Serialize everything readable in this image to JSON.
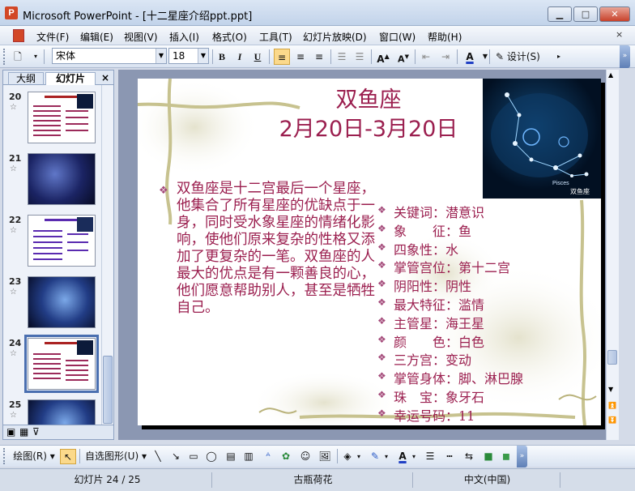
{
  "window": {
    "title": "Microsoft PowerPoint - [十二星座介绍ppt.ppt]",
    "icon": "powerpoint-icon",
    "controls": [
      "minimize",
      "maximize",
      "close"
    ]
  },
  "menu": {
    "items": [
      "文件(F)",
      "编辑(E)",
      "视图(V)",
      "插入(I)",
      "格式(O)",
      "工具(T)",
      "幻灯片放映(D)",
      "窗口(W)",
      "帮助(H)"
    ],
    "close_glyph": "×"
  },
  "toolbar": {
    "font_name": "宋体",
    "font_size": "18",
    "bold": "B",
    "italic": "I",
    "underline": "U",
    "design_label": "设计(S)",
    "grow_font": "A",
    "shrink_font": "A",
    "font_color": "A"
  },
  "left_panel": {
    "tabs": [
      "大纲",
      "幻灯片"
    ],
    "active_tab": "幻灯片",
    "close_glyph": "×",
    "thumbnails": [
      {
        "number": "20",
        "kind": "text"
      },
      {
        "number": "21",
        "kind": "image"
      },
      {
        "number": "22",
        "kind": "text"
      },
      {
        "number": "23",
        "kind": "image"
      },
      {
        "number": "24",
        "kind": "text",
        "selected": true
      },
      {
        "number": "25",
        "kind": "image"
      }
    ],
    "star_glyph": "☆"
  },
  "slide": {
    "title": "双鱼座",
    "date_range": "2月20日-3月20日",
    "image_caption_left": "Pisces",
    "image_caption_right": "双鱼座",
    "main_paragraph": "双鱼座是十二宫最后一个星座，他集合了所有星座的优缺点于一身，同时受水象星座的情绪化影响，使他们原来复杂的性格又添加了更复杂的一笔。双鱼座的人最大的优点是有一颗善良的心，他们愿意帮助别人，甚至是牺牲自己。",
    "attributes": [
      "关键词：潜意识",
      "象　　征：鱼",
      "四象性：水",
      "掌管宫位：第十二宫",
      "阴阳性：阴性",
      "最大特征：滥情",
      "主管星：海王星",
      "颜　　色：白色",
      "三方宫：变动",
      "掌管身体：脚、淋巴腺",
      "珠　宝：象牙石",
      "幸运号码：11"
    ],
    "bullet_glyph": "❖",
    "text_color": "#9b1f4f"
  },
  "drawing_toolbar": {
    "draw_label": "绘图(R)",
    "autoshapes_label": "自选图形(U)"
  },
  "status": {
    "slide_position": "幻灯片 24 / 25",
    "design_template": "古瓶荷花",
    "language": "中文(中国)"
  }
}
